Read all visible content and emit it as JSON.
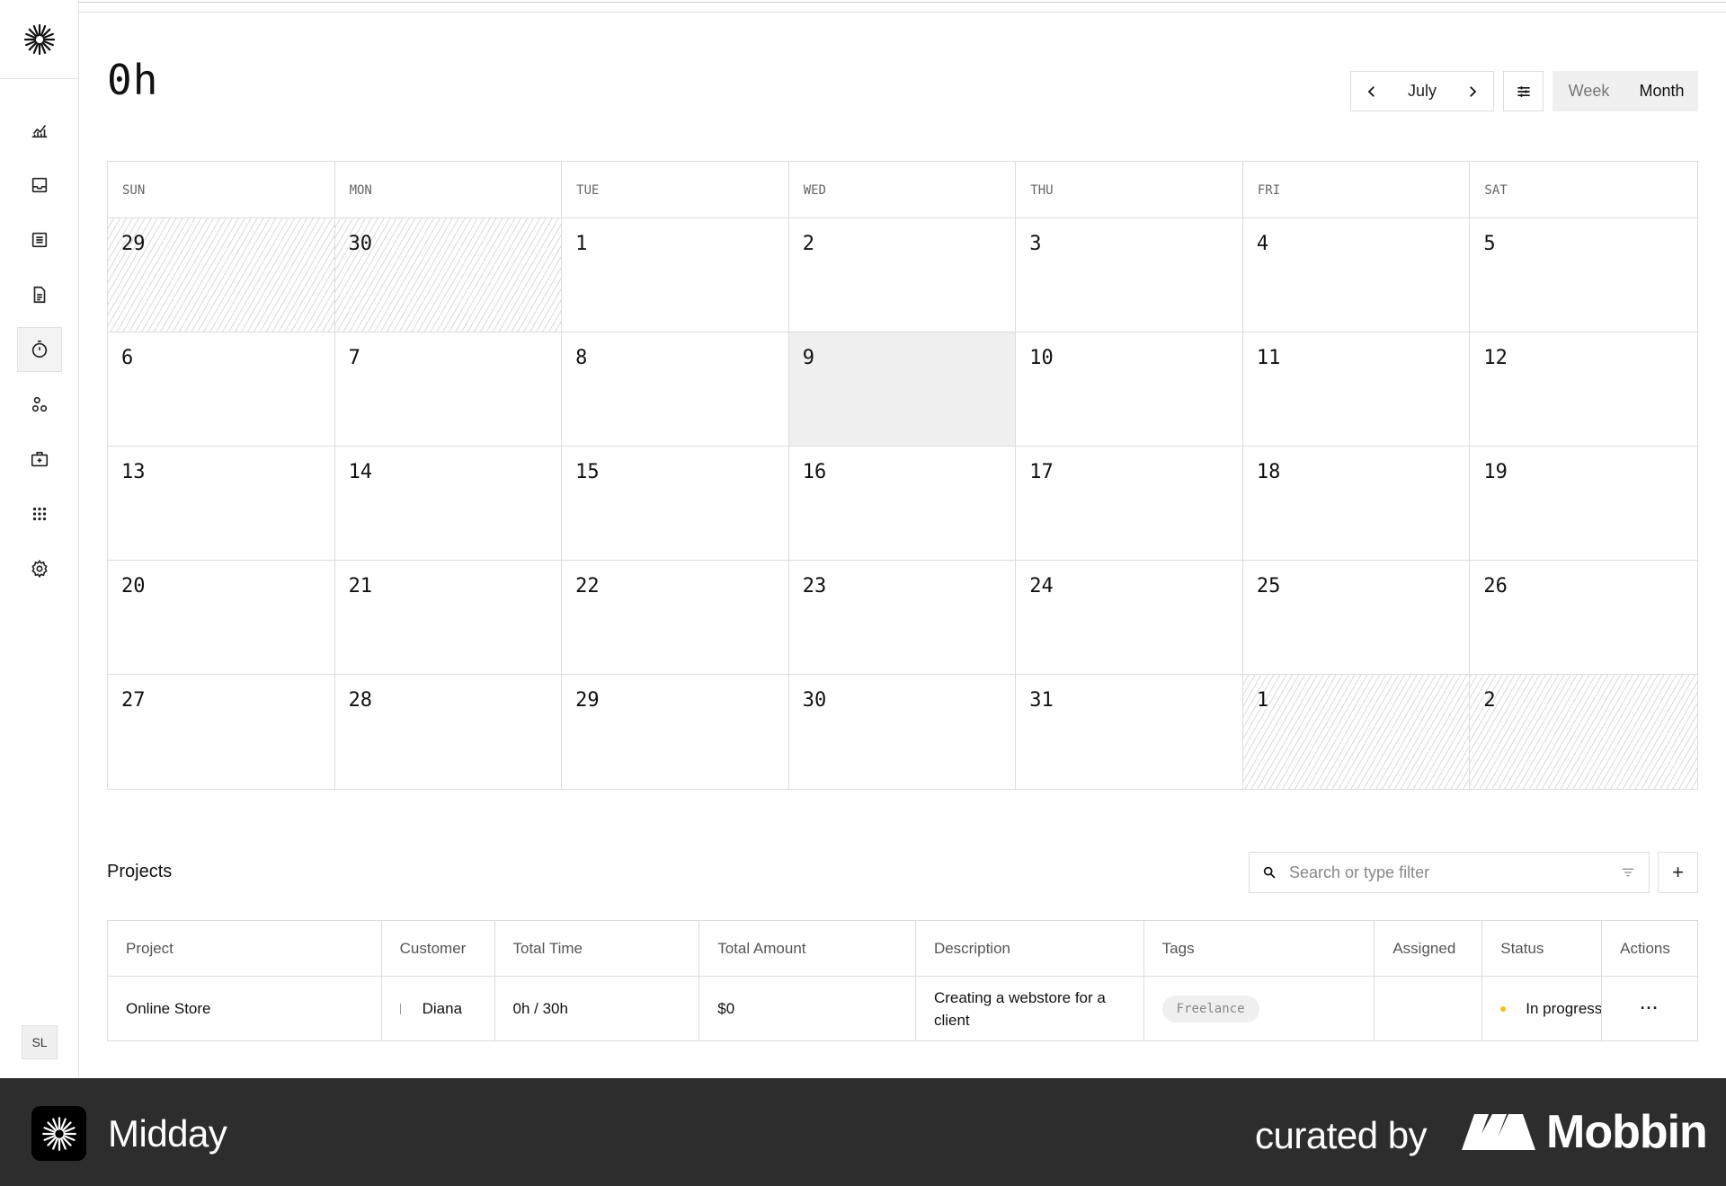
{
  "header": {
    "total_hours": "0h",
    "month": "July",
    "view_week": "Week",
    "view_month": "Month"
  },
  "sidebar": {
    "items": [
      {
        "icon": "chart-icon",
        "name": "overview"
      },
      {
        "icon": "inbox-icon",
        "name": "inbox"
      },
      {
        "icon": "transactions-icon",
        "name": "transactions"
      },
      {
        "icon": "invoice-icon",
        "name": "invoices"
      },
      {
        "icon": "timer-icon",
        "name": "tracker",
        "active": true
      },
      {
        "icon": "customers-icon",
        "name": "customers"
      },
      {
        "icon": "vault-icon",
        "name": "vault"
      },
      {
        "icon": "apps-icon",
        "name": "apps"
      },
      {
        "icon": "gear-icon",
        "name": "settings"
      }
    ],
    "avatar_initials": "SL"
  },
  "calendar": {
    "weekdays": [
      "SUN",
      "MON",
      "TUE",
      "WED",
      "THU",
      "FRI",
      "SAT"
    ],
    "weeks": [
      [
        "29",
        "30",
        "1",
        "2",
        "3",
        "4",
        "5"
      ],
      [
        "6",
        "7",
        "8",
        "9",
        "10",
        "11",
        "12"
      ],
      [
        "13",
        "14",
        "15",
        "16",
        "17",
        "18",
        "19"
      ],
      [
        "20",
        "21",
        "22",
        "23",
        "24",
        "25",
        "26"
      ],
      [
        "27",
        "28",
        "29",
        "30",
        "31",
        "1",
        "2"
      ]
    ],
    "outside_month_cells": [
      [
        0,
        0
      ],
      [
        0,
        1
      ],
      [
        4,
        5
      ],
      [
        4,
        6
      ]
    ],
    "highlighted_cell": [
      1,
      3
    ]
  },
  "projects": {
    "title": "Projects",
    "search_placeholder": "Search or type filter",
    "add_label": "+",
    "columns": [
      "Project",
      "Customer",
      "Total Time",
      "Total Amount",
      "Description",
      "Tags",
      "Assigned",
      "Status",
      "Actions"
    ],
    "rows": [
      {
        "project": "Online Store",
        "customer": "Diana",
        "total_time": "0h / 30h",
        "total_amount": "$0",
        "description": "Creating a webstore for a client",
        "tag": "Freelance",
        "assigned": "",
        "status": "In progress",
        "actions": "···"
      }
    ],
    "status_color": "#f2c21b"
  },
  "footer": {
    "app_name": "Midday",
    "curated_by": "curated by",
    "brand": "Mobbin"
  }
}
